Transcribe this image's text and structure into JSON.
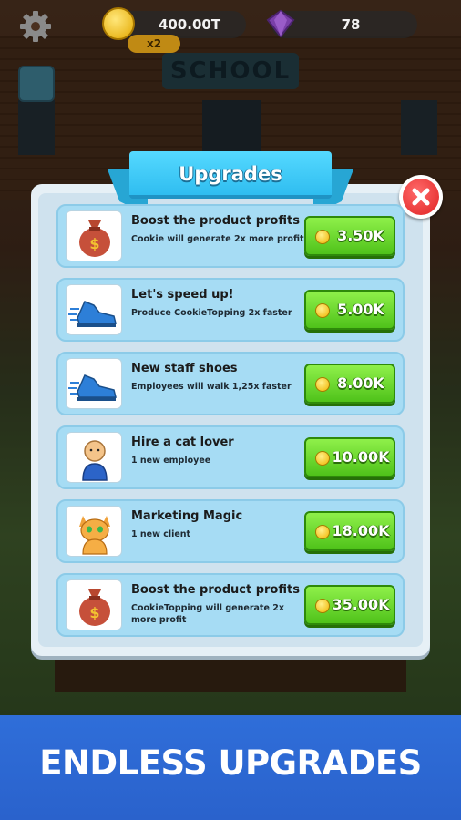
{
  "hud": {
    "coins": "400.00T",
    "multiplier": "x2",
    "gems": "78",
    "scene_sign": "SCHOOL"
  },
  "panel": {
    "title": "Upgrades",
    "close_icon": "close-x-icon"
  },
  "upgrades": [
    {
      "icon": "money-bag-icon",
      "title": "Boost the product profits",
      "description": "Cookie will generate 2x more profit",
      "price": "3.50K"
    },
    {
      "icon": "running-shoe-icon",
      "title": "Let's speed up!",
      "description": "Produce CookieTopping 2x faster",
      "price": "5.00K"
    },
    {
      "icon": "running-shoe-icon",
      "title": "New staff shoes",
      "description": "Employees will walk 1,25x faster",
      "price": "8.00K"
    },
    {
      "icon": "person-icon",
      "title": "Hire a cat lover",
      "description": "1 new employee",
      "price": "10.00K"
    },
    {
      "icon": "cat-icon",
      "title": "Marketing Magic",
      "description": "1 new client",
      "price": "18.00K"
    },
    {
      "icon": "money-bag-icon",
      "title": "Boost the product profits",
      "description": "CookieTopping will generate 2x more profit",
      "price": "35.00K"
    }
  ],
  "banner": {
    "text": "ENDLESS UPGRADES"
  },
  "colors": {
    "ribbon": "#2fbdf0",
    "buy_button": "#4fc21a",
    "close_button": "#e02222",
    "banner": "#2a62cc"
  }
}
